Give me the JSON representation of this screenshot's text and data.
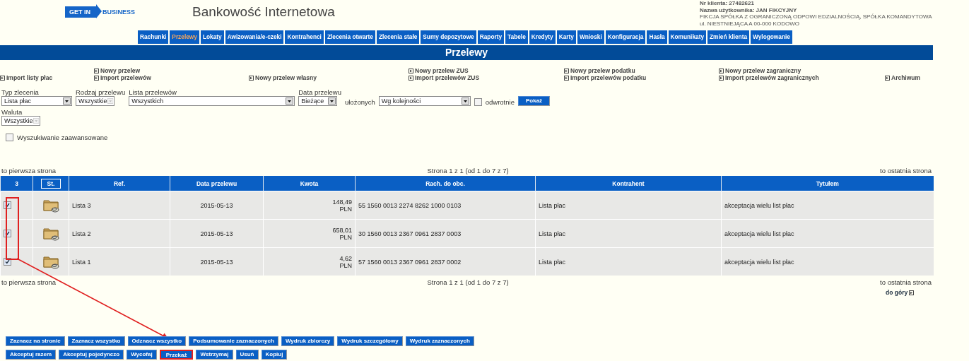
{
  "header": {
    "logo": {
      "left": "GET IN",
      "right": "BUSINESS"
    },
    "title": "Bankowość Internetowa",
    "client_info": [
      "Nr klienta: 27482621",
      "Nazwa użytkownika: JAN FIKCYJNY",
      "FIKCJA SPÓŁKA Z OGRANICZONĄ ODPOWI EDZIALNOŚCIĄ, SPÓŁKA KOMANDYTOWA",
      "ul. NIESTNIEJĄCA A 00-000 KODOWO"
    ]
  },
  "nav": [
    {
      "label": "Rachunki",
      "selected": false
    },
    {
      "label": "Przelewy",
      "selected": true
    },
    {
      "label": "Lokaty",
      "selected": false
    },
    {
      "label": "Awizowania/e-czeki",
      "selected": false
    },
    {
      "label": "Kontrahenci",
      "selected": false
    },
    {
      "label": "Zlecenia otwarte",
      "selected": false
    },
    {
      "label": "Zlecenia stałe",
      "selected": false
    },
    {
      "label": "Sumy depozytowe",
      "selected": false
    },
    {
      "label": "Raporty",
      "selected": false
    },
    {
      "label": "Tabele",
      "selected": false
    },
    {
      "label": "Kredyty",
      "selected": false
    },
    {
      "label": "Karty",
      "selected": false
    },
    {
      "label": "Wnioski",
      "selected": false
    },
    {
      "label": "Konfiguracja",
      "selected": false
    },
    {
      "label": "Hasła",
      "selected": false
    },
    {
      "label": "Komunikaty",
      "selected": false
    },
    {
      "label": "Zmień klienta",
      "selected": false
    },
    {
      "label": "Wylogowanie",
      "selected": false
    }
  ],
  "section_title": "Przelewy",
  "link_groups": [
    [
      "Import listy płac"
    ],
    [
      "Nowy przelew",
      "Import przelewów"
    ],
    [
      "Nowy przelew własny"
    ],
    [
      "Nowy przelew ZUS",
      "Import przelewów ZUS"
    ],
    [
      "Nowy przelew podatku",
      "Import przelewów podatku"
    ],
    [
      "Nowy przelew zagraniczny",
      "Import przelewów zagranicznych"
    ],
    [
      "Archiwum"
    ]
  ],
  "filters": [
    {
      "label": "Typ zlecenia",
      "value": "Lista płac",
      "disabled": false
    },
    {
      "label": "Rodzaj przelewu",
      "value": "Wszystkie",
      "disabled": true
    },
    {
      "label": "Lista przelewów",
      "value": "Wszystkich",
      "disabled": false
    },
    {
      "label": "Data przelewu",
      "value": "Bieżące",
      "disabled": false
    }
  ],
  "sort": {
    "label": "ułożonych",
    "value": "Wg kolejności",
    "reverse_label": "odwrotnie",
    "reverse_checked": false,
    "button": "Pokaż"
  },
  "currency": {
    "label": "Waluta",
    "value": "Wszystkie",
    "disabled": true
  },
  "advanced_search": {
    "label": "Wyszukiwanie zaawansowane",
    "checked": false
  },
  "pager_top": {
    "first": "to pierwsza strona",
    "info": "Strona 1 z 1 (od 1 do 7 z 7)",
    "last": "to ostatnia strona"
  },
  "table": {
    "columns": [
      "3",
      "St.",
      "Ref.",
      "Data przelewu",
      "Kwota",
      "Rach. do obc.",
      "Kontrahent",
      "Tytułem"
    ],
    "rows": [
      {
        "checked": true,
        "ref": "Lista 3",
        "date": "2015-05-13",
        "amount": "148,49",
        "currency": "PLN",
        "account": "55 1560 0013 2274 8262 1000 0103",
        "counterparty": "Lista płac",
        "title": "akceptacja wielu list płac"
      },
      {
        "checked": true,
        "ref": "Lista 2",
        "date": "2015-05-13",
        "amount": "658,01",
        "currency": "PLN",
        "account": "30 1560 0013 2367 0961 2837 0003",
        "counterparty": "Lista płac",
        "title": "akceptacja wielu list płac"
      },
      {
        "checked": true,
        "ref": "Lista 1",
        "date": "2015-05-13",
        "amount": "4,62",
        "currency": "PLN",
        "account": "57 1560 0013 2367 0961 2837 0002",
        "counterparty": "Lista płac",
        "title": "akceptacja wielu list płac"
      }
    ]
  },
  "pager_bottom": {
    "first": "to pierwsza strona",
    "info": "Strona 1 z 1 (od 1 do 7 z 7)",
    "last": "to ostatnia strona"
  },
  "top_link": "do góry",
  "action_rows": [
    [
      {
        "label": "Zaznacz na stronie",
        "highlighted": false
      },
      {
        "label": "Zaznacz wszystko",
        "highlighted": false
      },
      {
        "label": "Odznacz wszystko",
        "highlighted": false
      },
      {
        "label": "Podsumowanie zaznaczonych",
        "highlighted": false
      },
      {
        "label": "Wydruk zbiorczy",
        "highlighted": false
      },
      {
        "label": "Wydruk szczegółowy",
        "highlighted": false
      },
      {
        "label": "Wydruk zaznaczonych",
        "highlighted": false
      }
    ],
    [
      {
        "label": "Akceptuj razem",
        "highlighted": false
      },
      {
        "label": "Akceptuj pojedynczo",
        "highlighted": false
      },
      {
        "label": "Wycofaj",
        "highlighted": false
      },
      {
        "label": "Przekaż",
        "highlighted": true
      },
      {
        "label": "Wstrzymaj",
        "highlighted": false
      },
      {
        "label": "Usuń",
        "highlighted": false
      },
      {
        "label": "Kopiuj",
        "highlighted": false
      }
    ]
  ]
}
